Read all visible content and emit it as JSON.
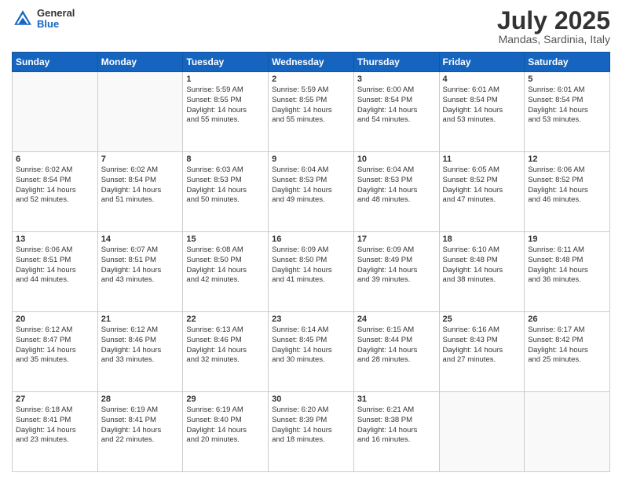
{
  "header": {
    "logo_general": "General",
    "logo_blue": "Blue",
    "title": "July 2025",
    "location": "Mandas, Sardinia, Italy"
  },
  "days_of_week": [
    "Sunday",
    "Monday",
    "Tuesday",
    "Wednesday",
    "Thursday",
    "Friday",
    "Saturday"
  ],
  "weeks": [
    [
      {
        "day": "",
        "empty": true
      },
      {
        "day": "",
        "empty": true
      },
      {
        "day": "1",
        "lines": [
          "Sunrise: 5:59 AM",
          "Sunset: 8:55 PM",
          "Daylight: 14 hours",
          "and 55 minutes."
        ]
      },
      {
        "day": "2",
        "lines": [
          "Sunrise: 5:59 AM",
          "Sunset: 8:55 PM",
          "Daylight: 14 hours",
          "and 55 minutes."
        ]
      },
      {
        "day": "3",
        "lines": [
          "Sunrise: 6:00 AM",
          "Sunset: 8:54 PM",
          "Daylight: 14 hours",
          "and 54 minutes."
        ]
      },
      {
        "day": "4",
        "lines": [
          "Sunrise: 6:01 AM",
          "Sunset: 8:54 PM",
          "Daylight: 14 hours",
          "and 53 minutes."
        ]
      },
      {
        "day": "5",
        "lines": [
          "Sunrise: 6:01 AM",
          "Sunset: 8:54 PM",
          "Daylight: 14 hours",
          "and 53 minutes."
        ]
      }
    ],
    [
      {
        "day": "6",
        "lines": [
          "Sunrise: 6:02 AM",
          "Sunset: 8:54 PM",
          "Daylight: 14 hours",
          "and 52 minutes."
        ]
      },
      {
        "day": "7",
        "lines": [
          "Sunrise: 6:02 AM",
          "Sunset: 8:54 PM",
          "Daylight: 14 hours",
          "and 51 minutes."
        ]
      },
      {
        "day": "8",
        "lines": [
          "Sunrise: 6:03 AM",
          "Sunset: 8:53 PM",
          "Daylight: 14 hours",
          "and 50 minutes."
        ]
      },
      {
        "day": "9",
        "lines": [
          "Sunrise: 6:04 AM",
          "Sunset: 8:53 PM",
          "Daylight: 14 hours",
          "and 49 minutes."
        ]
      },
      {
        "day": "10",
        "lines": [
          "Sunrise: 6:04 AM",
          "Sunset: 8:53 PM",
          "Daylight: 14 hours",
          "and 48 minutes."
        ]
      },
      {
        "day": "11",
        "lines": [
          "Sunrise: 6:05 AM",
          "Sunset: 8:52 PM",
          "Daylight: 14 hours",
          "and 47 minutes."
        ]
      },
      {
        "day": "12",
        "lines": [
          "Sunrise: 6:06 AM",
          "Sunset: 8:52 PM",
          "Daylight: 14 hours",
          "and 46 minutes."
        ]
      }
    ],
    [
      {
        "day": "13",
        "lines": [
          "Sunrise: 6:06 AM",
          "Sunset: 8:51 PM",
          "Daylight: 14 hours",
          "and 44 minutes."
        ]
      },
      {
        "day": "14",
        "lines": [
          "Sunrise: 6:07 AM",
          "Sunset: 8:51 PM",
          "Daylight: 14 hours",
          "and 43 minutes."
        ]
      },
      {
        "day": "15",
        "lines": [
          "Sunrise: 6:08 AM",
          "Sunset: 8:50 PM",
          "Daylight: 14 hours",
          "and 42 minutes."
        ]
      },
      {
        "day": "16",
        "lines": [
          "Sunrise: 6:09 AM",
          "Sunset: 8:50 PM",
          "Daylight: 14 hours",
          "and 41 minutes."
        ]
      },
      {
        "day": "17",
        "lines": [
          "Sunrise: 6:09 AM",
          "Sunset: 8:49 PM",
          "Daylight: 14 hours",
          "and 39 minutes."
        ]
      },
      {
        "day": "18",
        "lines": [
          "Sunrise: 6:10 AM",
          "Sunset: 8:48 PM",
          "Daylight: 14 hours",
          "and 38 minutes."
        ]
      },
      {
        "day": "19",
        "lines": [
          "Sunrise: 6:11 AM",
          "Sunset: 8:48 PM",
          "Daylight: 14 hours",
          "and 36 minutes."
        ]
      }
    ],
    [
      {
        "day": "20",
        "lines": [
          "Sunrise: 6:12 AM",
          "Sunset: 8:47 PM",
          "Daylight: 14 hours",
          "and 35 minutes."
        ]
      },
      {
        "day": "21",
        "lines": [
          "Sunrise: 6:12 AM",
          "Sunset: 8:46 PM",
          "Daylight: 14 hours",
          "and 33 minutes."
        ]
      },
      {
        "day": "22",
        "lines": [
          "Sunrise: 6:13 AM",
          "Sunset: 8:46 PM",
          "Daylight: 14 hours",
          "and 32 minutes."
        ]
      },
      {
        "day": "23",
        "lines": [
          "Sunrise: 6:14 AM",
          "Sunset: 8:45 PM",
          "Daylight: 14 hours",
          "and 30 minutes."
        ]
      },
      {
        "day": "24",
        "lines": [
          "Sunrise: 6:15 AM",
          "Sunset: 8:44 PM",
          "Daylight: 14 hours",
          "and 28 minutes."
        ]
      },
      {
        "day": "25",
        "lines": [
          "Sunrise: 6:16 AM",
          "Sunset: 8:43 PM",
          "Daylight: 14 hours",
          "and 27 minutes."
        ]
      },
      {
        "day": "26",
        "lines": [
          "Sunrise: 6:17 AM",
          "Sunset: 8:42 PM",
          "Daylight: 14 hours",
          "and 25 minutes."
        ]
      }
    ],
    [
      {
        "day": "27",
        "lines": [
          "Sunrise: 6:18 AM",
          "Sunset: 8:41 PM",
          "Daylight: 14 hours",
          "and 23 minutes."
        ]
      },
      {
        "day": "28",
        "lines": [
          "Sunrise: 6:19 AM",
          "Sunset: 8:41 PM",
          "Daylight: 14 hours",
          "and 22 minutes."
        ]
      },
      {
        "day": "29",
        "lines": [
          "Sunrise: 6:19 AM",
          "Sunset: 8:40 PM",
          "Daylight: 14 hours",
          "and 20 minutes."
        ]
      },
      {
        "day": "30",
        "lines": [
          "Sunrise: 6:20 AM",
          "Sunset: 8:39 PM",
          "Daylight: 14 hours",
          "and 18 minutes."
        ]
      },
      {
        "day": "31",
        "lines": [
          "Sunrise: 6:21 AM",
          "Sunset: 8:38 PM",
          "Daylight: 14 hours",
          "and 16 minutes."
        ]
      },
      {
        "day": "",
        "empty": true
      },
      {
        "day": "",
        "empty": true
      }
    ]
  ]
}
